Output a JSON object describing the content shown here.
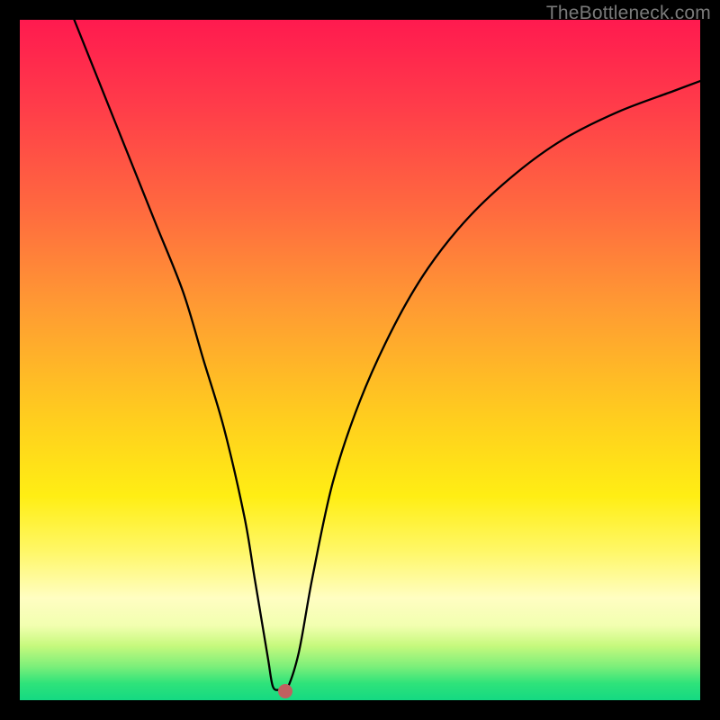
{
  "watermark": "TheBottleneck.com",
  "chart_data": {
    "type": "line",
    "title": "",
    "xlabel": "",
    "ylabel": "",
    "xlim": [
      0,
      100
    ],
    "ylim": [
      0,
      100
    ],
    "series": [
      {
        "name": "curve",
        "x": [
          8,
          12,
          16,
          20,
          24,
          27,
          30,
          33,
          34.5,
          35.5,
          36.5,
          37.2,
          38.2,
          39.2,
          41,
          43,
          46,
          50,
          55,
          60,
          66,
          73,
          80,
          88,
          96,
          100
        ],
        "y": [
          100,
          90,
          80,
          70,
          60,
          50,
          40,
          27,
          18,
          12,
          6,
          2,
          1.5,
          1.5,
          7,
          18,
          32,
          44,
          55,
          63.5,
          71,
          77.5,
          82.5,
          86.5,
          89.5,
          91
        ]
      }
    ],
    "marker": {
      "x": 39.0,
      "y": 1.3
    },
    "gradient_stops": [
      {
        "pos": 0,
        "color": "#ff1a4f"
      },
      {
        "pos": 50,
        "color": "#ffd21f"
      },
      {
        "pos": 85,
        "color": "#fffec2"
      },
      {
        "pos": 100,
        "color": "#14d982"
      }
    ]
  }
}
